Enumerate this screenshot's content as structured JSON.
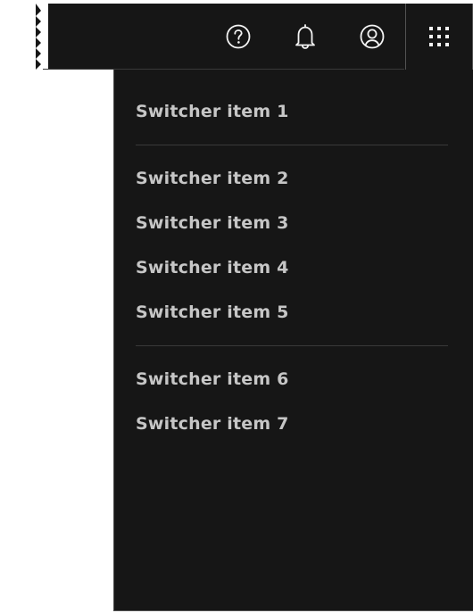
{
  "header": {
    "actions": [
      {
        "name": "help",
        "icon": "help-icon"
      },
      {
        "name": "notifications",
        "icon": "bell-icon"
      },
      {
        "name": "user",
        "icon": "user-avatar-icon"
      },
      {
        "name": "switcher",
        "icon": "app-switcher-grid-icon",
        "active": true
      }
    ]
  },
  "switcher": {
    "groups": [
      [
        "Switcher item 1"
      ],
      [
        "Switcher item 2",
        "Switcher item 3",
        "Switcher item 4",
        "Switcher item 5"
      ],
      [
        "Switcher item 6",
        "Switcher item 7"
      ]
    ]
  },
  "colors": {
    "background": "#161616",
    "text": "#c6c6c6",
    "divider": "#393939",
    "icon": "#f4f4f4",
    "page": "#ffffff"
  }
}
